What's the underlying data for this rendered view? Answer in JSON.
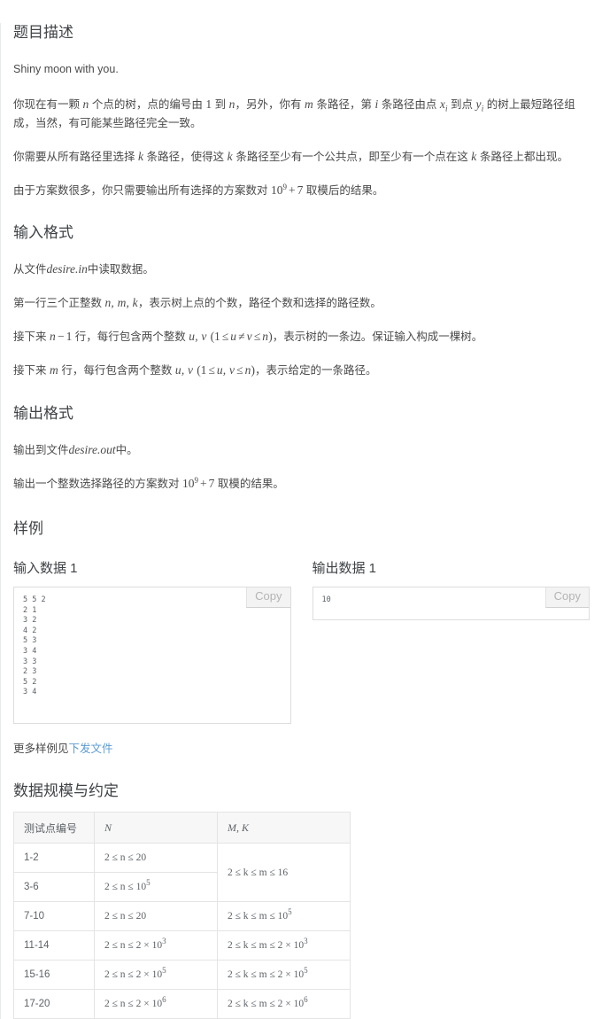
{
  "sections": {
    "description": {
      "heading": "题目描述",
      "flavor": "Shiny moon with you.",
      "p1_a": "你现在有一颗 ",
      "p1_n": "n",
      "p1_b": " 个点的树，点的编号由 ",
      "p1_one": "1",
      "p1_c": " 到 ",
      "p1_n2": "n",
      "p1_d": "，另外，你有 ",
      "p1_m": "m",
      "p1_e": " 条路径，第 ",
      "p1_i": "i",
      "p1_f": " 条路径由点 ",
      "p1_x": "x",
      "p1_xs": "i",
      "p1_g": " 到点 ",
      "p1_y": "y",
      "p1_ys": "i",
      "p1_h": " 的树上最短路径组成，当然，有可能某些路径完全一致。",
      "p2_a": "你需要从所有路径里选择 ",
      "p2_k": "k",
      "p2_b": " 条路径，使得这 ",
      "p2_k2": "k",
      "p2_c": " 条路径至少有一个公共点，即至少有一个点在这 ",
      "p2_k3": "k",
      "p2_d": " 条路径上都出现。",
      "p3_a": "由于方案数很多，你只需要输出所有选择的方案数对 ",
      "p3_base": "10",
      "p3_exp": "9",
      "p3_plus": "+",
      "p3_seven": "7",
      "p3_b": " 取模后的结果。"
    },
    "input_format": {
      "heading": "输入格式",
      "l1_a": "从文件",
      "l1_file": "desire.in",
      "l1_b": "中读取数据。",
      "l2_a": "第一行三个正整数 ",
      "l2_vars": "n, m, k",
      "l2_b": "，表示树上点的个数，路径个数和选择的路径数。",
      "l3_a": "接下来 ",
      "l3_n": "n",
      "l3_minus": "−",
      "l3_one": "1",
      "l3_b": " 行，每行包含两个整数 ",
      "l3_uv": "u, v",
      "l3_cond_open": "(1",
      "l3_le1": "≤",
      "l3_u": "u",
      "l3_neq": "≠",
      "l3_v": "v",
      "l3_le2": "≤",
      "l3_nn": "n",
      "l3_cond_close": ")",
      "l3_c": "，表示树的一条边。保证输入构成一棵树。",
      "l4_a": "接下来 ",
      "l4_m": "m",
      "l4_b": " 行，每行包含两个整数 ",
      "l4_uv": "u, v",
      "l4_cond_open": "(1",
      "l4_le1": "≤",
      "l4_uv2": "u, v",
      "l4_le2": "≤",
      "l4_nn": "n",
      "l4_cond_close": ")",
      "l4_c": "，表示给定的一条路径。"
    },
    "output_format": {
      "heading": "输出格式",
      "l1_a": "输出到文件",
      "l1_file": "desire.out",
      "l1_b": "中。",
      "l2_a": "输出一个整数选择路径的方案数对 ",
      "l2_base": "10",
      "l2_exp": "9",
      "l2_plus": "+",
      "l2_seven": "7",
      "l2_b": " 取模的结果。"
    },
    "samples": {
      "heading": "样例",
      "input_title": "输入数据 1",
      "output_title": "输出数据 1",
      "copy_label": "Copy",
      "input_text": "5 5 2\n2 1\n3 2\n4 2\n5 3\n3 4\n3 3\n2 3\n5 2\n3 4",
      "output_text": "10",
      "more_prefix": "更多样例见",
      "more_link": "下发文件"
    },
    "constraints": {
      "heading": "数据规模与约定",
      "headers": [
        "测试点编号",
        "N",
        "M, K"
      ],
      "rows": [
        {
          "idx": "1-2",
          "n": "2 ≤ n ≤ 20",
          "mk": "2 ≤ k ≤ m ≤ 16",
          "mk_rowspan": 2
        },
        {
          "idx": "3-6",
          "n_a": "2 ≤ n ≤ 10",
          "n_exp": "5"
        },
        {
          "idx": "7-10",
          "n": "2 ≤ n ≤ 20",
          "mk_a": "2 ≤ k ≤ m ≤ 10",
          "mk_exp": "5"
        },
        {
          "idx": "11-14",
          "n_a": "2 ≤ n ≤ 2 × 10",
          "n_exp": "3",
          "mk_a": "2 ≤ k ≤ m ≤ 2 × 10",
          "mk_exp": "3"
        },
        {
          "idx": "15-16",
          "n_a": "2 ≤ n ≤ 2 × 10",
          "n_exp": "5",
          "mk_a": "2 ≤ k ≤ m ≤ 2 × 10",
          "mk_exp": "5"
        },
        {
          "idx": "17-20",
          "n_a": "2 ≤ n ≤ 2 × 10",
          "n_exp": "6",
          "mk_a": "2 ≤ k ≤ m ≤ 2 × 10",
          "mk_exp": "6"
        }
      ]
    }
  },
  "colors": {
    "text": "#4a4a4a",
    "heading": "#3f4346",
    "link": "#5b9bd5",
    "border": "#e4e4e4",
    "table_header_bg": "#f7f7f7",
    "copy_bg": "#f3f3f3"
  }
}
